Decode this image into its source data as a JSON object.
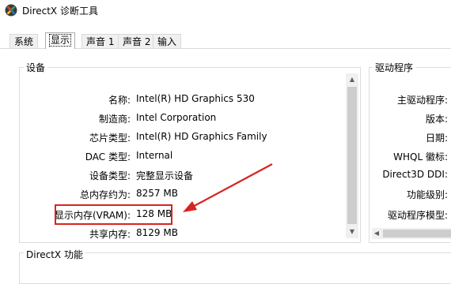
{
  "window": {
    "title": "DirectX 诊断工具",
    "icon": "directx-x-icon"
  },
  "tabs": [
    {
      "label": "系统"
    },
    {
      "label": "显示",
      "active": true
    },
    {
      "label": "声音 1"
    },
    {
      "label": "声音 2"
    },
    {
      "label": "输入"
    }
  ],
  "device": {
    "group_label": "设备",
    "rows": [
      {
        "label": "名称:",
        "value": "Intel(R) HD Graphics 530"
      },
      {
        "label": "制造商:",
        "value": "Intel Corporation"
      },
      {
        "label": "芯片类型:",
        "value": "Intel(R) HD Graphics Family"
      },
      {
        "label": "DAC 类型:",
        "value": "Internal"
      },
      {
        "label": "设备类型:",
        "value": "完整显示设备"
      },
      {
        "label": "总内存约为:",
        "value": "8257 MB"
      },
      {
        "label": "显示内存(VRAM):",
        "value": "128 MB",
        "highlighted": true
      },
      {
        "label": "共享内存:",
        "value": "8129 MB"
      }
    ]
  },
  "drivers": {
    "group_label": "驱动程序",
    "labels": [
      "主驱动程序:",
      "版本:",
      "日期:",
      "WHQL 徽标:",
      "Direct3D DDI:",
      "功能级别:",
      "驱动程序模型:"
    ]
  },
  "features": {
    "group_label": "DirectX 功能"
  },
  "annotation": {
    "color": "#d9231e"
  }
}
